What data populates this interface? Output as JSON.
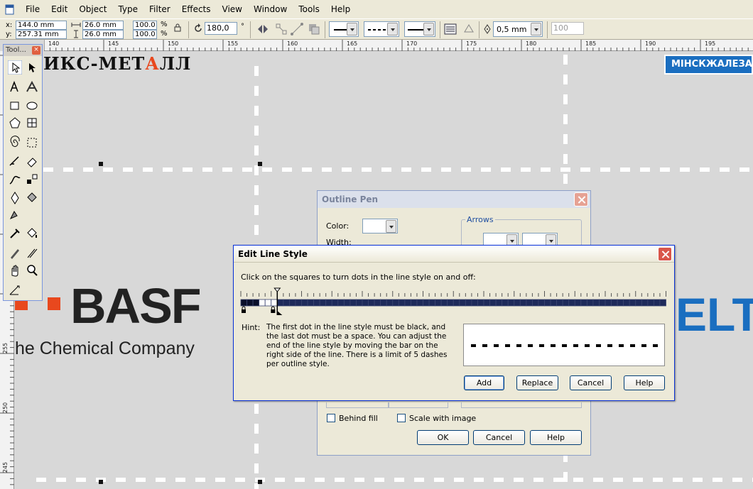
{
  "menubar": {
    "items": [
      "File",
      "Edit",
      "Object",
      "Type",
      "Filter",
      "Effects",
      "View",
      "Window",
      "Tools",
      "Help"
    ]
  },
  "propbar": {
    "x_label": "x:",
    "x_value": "144.0 mm",
    "y_label": "y:",
    "y_value": "257.31 mm",
    "width_value": "26.0 mm",
    "height_value": "26.0 mm",
    "scale_x": "100.0",
    "scale_y": "100.0",
    "percent": "%",
    "angle_value": "180,0",
    "degree": "°",
    "outline_width": "0,5 mm",
    "miter_value": "100"
  },
  "ruler": {
    "h_labels": [
      "140",
      "145",
      "150",
      "155",
      "160",
      "165",
      "170",
      "175",
      "180",
      "185",
      "190",
      "195"
    ],
    "v_labels": [
      "255",
      "250",
      "245"
    ]
  },
  "toolbox": {
    "title": "Tool..."
  },
  "canvas": {
    "metal_text_1": "ИКС-МЕТ",
    "metal_text_2": "А",
    "metal_text_3": "ЛЛ",
    "minsk_text": "МІНСКЖАЛЕЗАБЕТ",
    "basf_text": "BASF",
    "chemical_text": "he Chemical Company",
    "elt_text": "ELT"
  },
  "outline_pen": {
    "title": "Outline Pen",
    "color_label": "Color:",
    "width_label": "Width:",
    "arrows_label": "Arrows",
    "behind_fill_label": "Behind fill",
    "scale_with_image_label": "Scale with image",
    "ok_label": "OK",
    "cancel_label": "Cancel",
    "help_label": "Help"
  },
  "edit_line_style": {
    "title": "Edit Line Style",
    "instruction": "Click on the squares to turn dots in the line style on and off:",
    "hint_label": "Hint:",
    "hint_text": "The first dot in the line style must be black, and the last dot must be a space. You can adjust the end of the line style by moving the bar on the right side of the line. There is a limit of 5 dashes per outline style.",
    "add_label": "Add",
    "replace_label": "Replace",
    "cancel_label": "Cancel",
    "help_label": "Help",
    "pattern": [
      1,
      1,
      1,
      0,
      0,
      0
    ]
  },
  "colors": {
    "titlebar_active": "#0a246a",
    "dialog_bg": "#ece9d8",
    "basf_orange": "#e8481e",
    "brand_blue": "#1a6ec0",
    "metal_red": "#e8481e"
  }
}
